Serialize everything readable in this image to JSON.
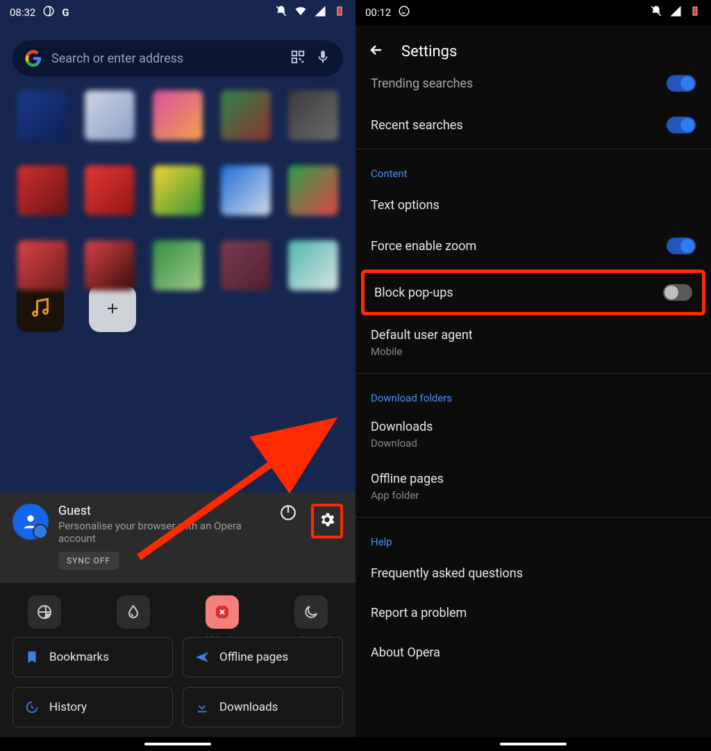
{
  "left": {
    "status": {
      "time": "08:32"
    },
    "search": {
      "placeholder": "Search or enter address"
    },
    "account": {
      "name": "Guest",
      "subtitle": "Personalise your browser with an Opera account",
      "sync_label": "SYNC OFF"
    },
    "quick": [
      {
        "label": "VPN",
        "state": "Off"
      },
      {
        "label": "Data savings",
        "state": "Off"
      },
      {
        "label": "Ad blocking",
        "state": "On"
      },
      {
        "label": "Night mode",
        "state": "Off"
      }
    ],
    "buttons": {
      "bookmarks": "Bookmarks",
      "offline": "Offline pages",
      "history": "History",
      "downloads": "Downloads"
    }
  },
  "right": {
    "status": {
      "time": "00:12"
    },
    "header": {
      "title": "Settings"
    },
    "rows": {
      "trending": "Trending searches",
      "recent": "Recent searches",
      "content_section": "Content",
      "text_options": "Text options",
      "force_zoom": "Force enable zoom",
      "block_popups": "Block pop-ups",
      "default_ua": "Default user agent",
      "default_ua_sub": "Mobile",
      "download_section": "Download folders",
      "downloads": "Downloads",
      "downloads_sub": "Download",
      "offline": "Offline pages",
      "offline_sub": "App folder",
      "help_section": "Help",
      "faq": "Frequently asked questions",
      "report": "Report a problem",
      "about": "About Opera"
    }
  }
}
